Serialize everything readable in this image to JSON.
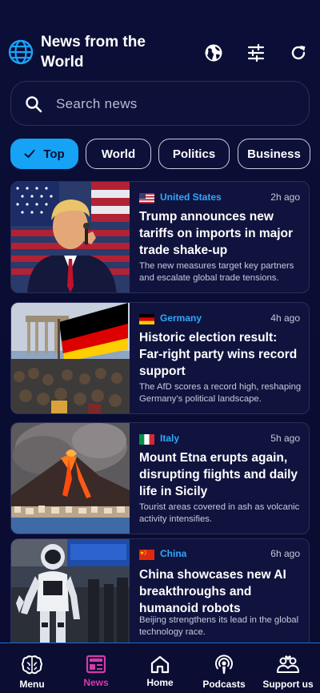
{
  "header": {
    "title": "News from the World",
    "icons": [
      "globe-logo-icon",
      "globe-icon",
      "filter-icon",
      "refresh-icon"
    ]
  },
  "search": {
    "placeholder": "Search news"
  },
  "categories": [
    {
      "label": "Top",
      "active": true
    },
    {
      "label": "World",
      "active": false
    },
    {
      "label": "Politics",
      "active": false
    },
    {
      "label": "Business",
      "active": false
    }
  ],
  "articles": [
    {
      "country": "United States",
      "flag": "us",
      "time": "2h ago",
      "headline": "Trump announces new tariffs on imports in major trade shake-up",
      "summary": "The new measures target key partners and escalate global trade tensions."
    },
    {
      "country": "Germany",
      "flag": "de",
      "time": "4h ago",
      "headline": "Historic election result: Far-right party wins record support",
      "summary": "The AfD scores a record high, reshaping Germany's political landscape."
    },
    {
      "country": "Italy",
      "flag": "it",
      "time": "5h ago",
      "headline": "Mount Etna erupts again, disrupting fiights and daily life in Sicily",
      "summary": "Tourist areas covered in ash as volcanic activity intensifies."
    },
    {
      "country": "China",
      "flag": "cn",
      "time": "6h ago",
      "headline": "China showcases new AI breakthroughs and humanoid robots",
      "summary": "Beijing strengthens its lead in the global technology race."
    }
  ],
  "bottom_nav": [
    {
      "label": "Menu",
      "icon": "brain-icon",
      "active": false
    },
    {
      "label": "News",
      "icon": "news-icon",
      "active": true
    },
    {
      "label": "Home",
      "icon": "home-icon",
      "active": false
    },
    {
      "label": "Podcasts",
      "icon": "podcast-icon",
      "active": false
    },
    {
      "label": "Support us",
      "icon": "support-icon",
      "active": false
    }
  ],
  "colors": {
    "background": "#0b0d33",
    "accent": "#16a2f5",
    "country": "#2fa8ff",
    "active_nav": "#d43aa9"
  }
}
